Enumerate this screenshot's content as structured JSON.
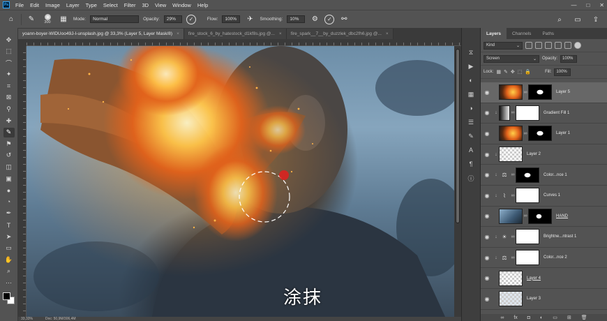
{
  "menu": {
    "logo": "Ps",
    "items": [
      "File",
      "Edit",
      "Image",
      "Layer",
      "Type",
      "Select",
      "Filter",
      "3D",
      "View",
      "Window",
      "Help"
    ]
  },
  "window": {
    "minimize": "—",
    "maximize": "□",
    "close": "✕"
  },
  "options": {
    "brush_size": "300",
    "mode_label": "Mode:",
    "mode_value": "Normal",
    "opacity_label": "Opacity:",
    "opacity_value": "29%",
    "flow_label": "Flow:",
    "flow_value": "100%",
    "smoothing_label": "Smoothing:",
    "smoothing_value": "10%"
  },
  "tabs": [
    {
      "label": "yoann-boyer-WIDUoo49J-I-unsplash.jpg @ 33,3% (Layer 5, Layer Mask/8)",
      "close": "×"
    },
    {
      "label": "fire_stock_6_by_hatestock_d1kf8s.jpg @...",
      "close": "×"
    },
    {
      "label": "fire_spark__7__by_duzzlek_dbc2fh6.jpg @...",
      "close": "×"
    }
  ],
  "status": {
    "zoom": "33,33%",
    "doc": "Doc: 50,9M/306,4M"
  },
  "subtitle": "涂抹",
  "layers_panel": {
    "tabs": [
      "Layers",
      "Channels",
      "Paths"
    ],
    "filter_kind": "Kind",
    "blend_mode": "Screen",
    "opacity_label": "Opacity:",
    "opacity_value": "100%",
    "lock_label": "Lock:",
    "fill_label": "Fill:",
    "fill_value": "100%",
    "layers": [
      {
        "name": "Layer 5",
        "selected": true
      },
      {
        "name": "Gradient Fill 1",
        "selected": false
      },
      {
        "name": "Layer 1",
        "selected": false
      },
      {
        "name": "Layer 2",
        "selected": false
      },
      {
        "name": "Color...nce 1",
        "selected": false
      },
      {
        "name": "Curves 1",
        "selected": false
      },
      {
        "name": "HAND",
        "selected": false
      },
      {
        "name": "Brightne...ntrast 1",
        "selected": false
      },
      {
        "name": "Color...nce 2",
        "selected": false
      },
      {
        "name": "Layer 4",
        "selected": false
      },
      {
        "name": "Layer 3",
        "selected": false
      }
    ]
  },
  "colors": {
    "chrome": "#535353",
    "panel_dark": "#3c3c3c",
    "accent_red": "#e0201f",
    "fire": "#f3a12a"
  }
}
